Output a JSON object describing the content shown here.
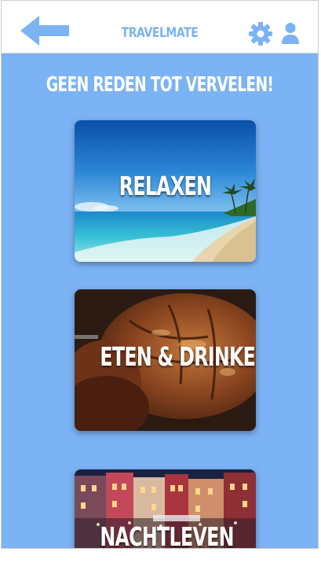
{
  "header": {
    "title": "TRAVELMATE",
    "back_icon": "arrow-left-icon",
    "settings_icon": "gear-icon",
    "profile_icon": "user-icon"
  },
  "main": {
    "headline": "GEEN REDEN TOT VERVELEN!",
    "categories": [
      {
        "label": "RELAXEN",
        "image": "beach-photo"
      },
      {
        "label": "ETEN & DRINKEN",
        "image": "grilled-meat-photo"
      },
      {
        "label": "NACHTLEVEN",
        "image": "city-night-photo"
      }
    ]
  },
  "colors": {
    "accent": "#7bb3f4",
    "background": "#7bb3f4",
    "header_bg": "#ffffff",
    "text_light": "#ffffff"
  }
}
